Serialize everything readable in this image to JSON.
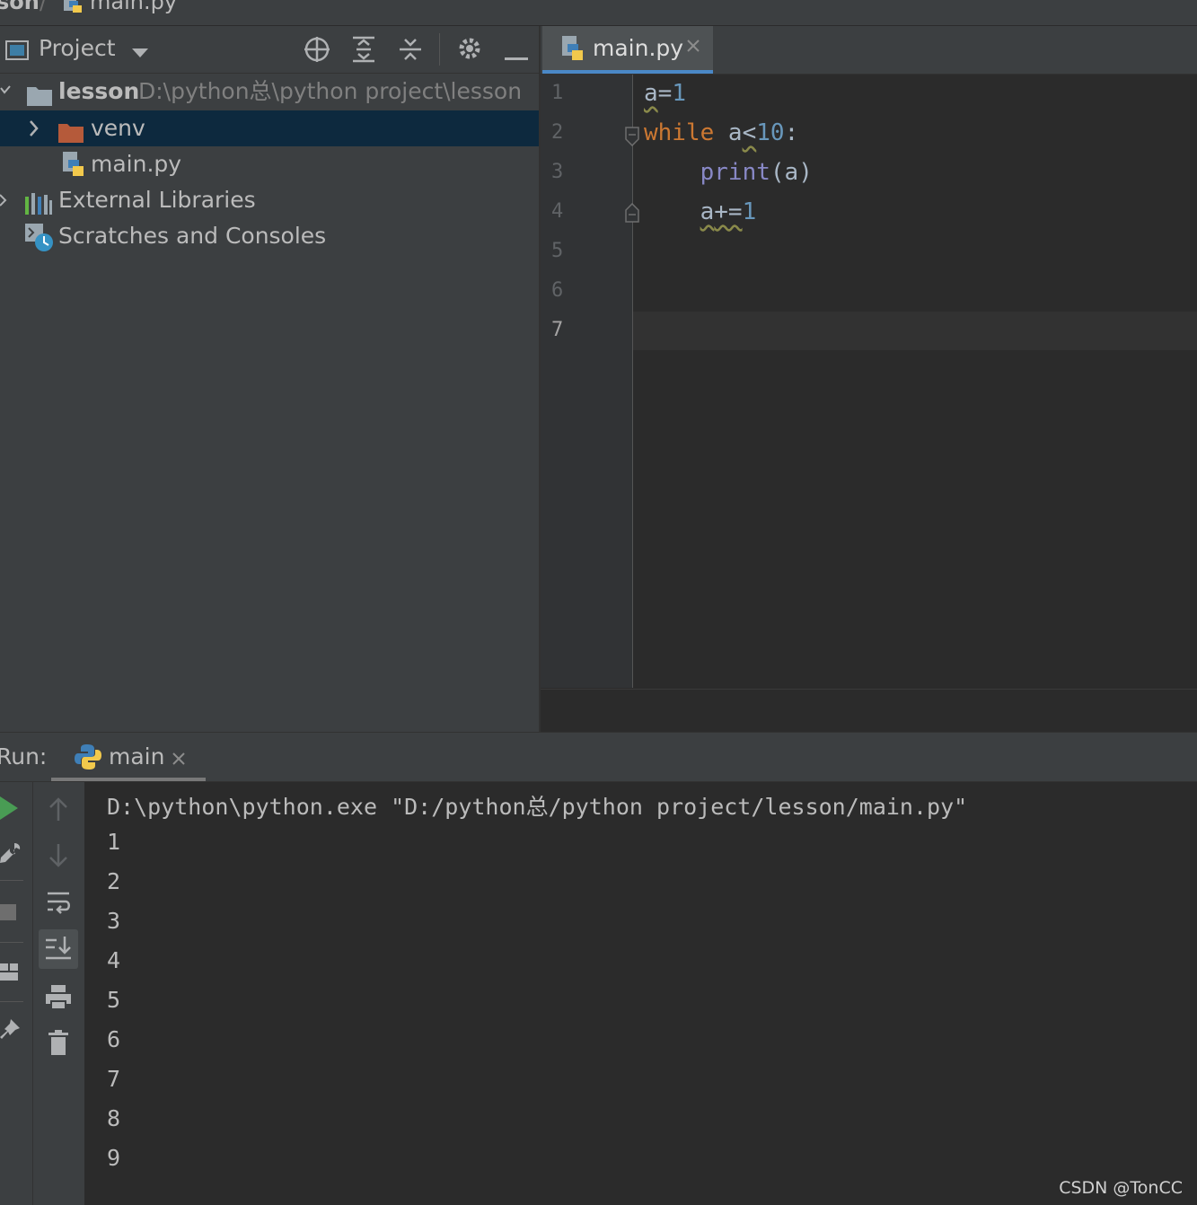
{
  "breadcrumb": {
    "project": "son",
    "separator": "/",
    "file": "main.py"
  },
  "project_panel": {
    "title": "Project",
    "tree": [
      {
        "name": "lesson",
        "path": "D:\\python总\\python project\\lesson"
      },
      {
        "name": "venv"
      },
      {
        "name": "main.py"
      },
      {
        "name": "External Libraries"
      },
      {
        "name": "Scratches and Consoles"
      }
    ]
  },
  "editor": {
    "tab_label": "main.py",
    "line_numbers": [
      "1",
      "2",
      "3",
      "4",
      "5",
      "6",
      "7"
    ],
    "code": {
      "l1_var": "a",
      "l1_op": "=",
      "l1_num": "1",
      "l2_kw": "while",
      "l2_var": " a",
      "l2_op": "<",
      "l2_num": "10",
      "l2_colon": ":",
      "l3_indent": "    ",
      "l3_fn": "print",
      "l3_args": "(a)",
      "l4_indent": "    ",
      "l4_var": "a",
      "l4_op": "+=",
      "l4_num": "1"
    }
  },
  "run_panel": {
    "label": "Run:",
    "tab_label": "main",
    "console_lines": [
      "D:\\python\\python.exe \"D:/python总/python project/lesson/main.py\"",
      "1",
      "2",
      "3",
      "4",
      "5",
      "6",
      "7",
      "8",
      "9"
    ]
  },
  "watermark": "CSDN @TonCC",
  "colors": {
    "keyword": "#cc7832",
    "number": "#6897bb",
    "builtin": "#8888c6",
    "accent": "#4a88c7",
    "run_green": "#499c54"
  }
}
